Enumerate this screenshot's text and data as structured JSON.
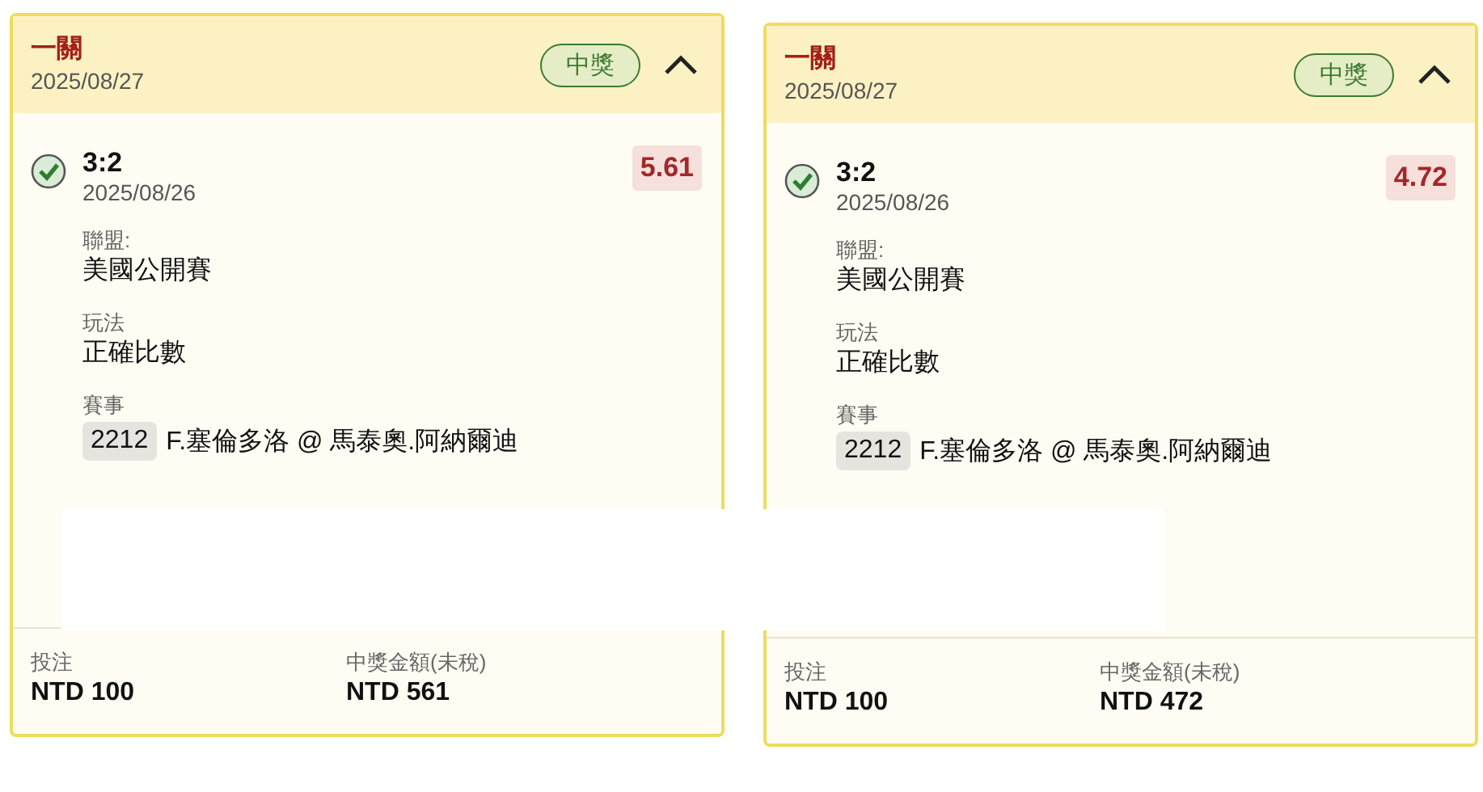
{
  "cards": [
    {
      "title": "一關",
      "date": "2025/08/27",
      "status": "中獎",
      "expanded": true,
      "selection": {
        "checked": true,
        "pick": "3:2",
        "date": "2025/08/26",
        "odds": "5.61"
      },
      "fields": [
        {
          "label": "聯盟:",
          "value": "美國公開賽"
        },
        {
          "label": "玩法",
          "value": "正確比數"
        }
      ],
      "event": {
        "label": "賽事",
        "code": "2212",
        "name": "F.塞倫多洛 @ 馬泰奧.阿納爾迪"
      },
      "footer": [
        {
          "label": "投注",
          "value": "NTD 100"
        },
        {
          "label": "中獎金額(未稅)",
          "value": "NTD 561"
        }
      ]
    },
    {
      "title": "一關",
      "date": "2025/08/27",
      "status": "中獎",
      "expanded": true,
      "selection": {
        "checked": true,
        "pick": "3:2",
        "date": "2025/08/26",
        "odds": "4.72"
      },
      "fields": [
        {
          "label": "聯盟:",
          "value": "美國公開賽"
        },
        {
          "label": "玩法",
          "value": "正確比數"
        }
      ],
      "event": {
        "label": "賽事",
        "code": "2212",
        "name": "F.塞倫多洛 @ 馬泰奧.阿納爾迪"
      },
      "footer": [
        {
          "label": "投注",
          "value": "NTD 100"
        },
        {
          "label": "中獎金額(未稅)",
          "value": "NTD 472"
        }
      ]
    }
  ]
}
